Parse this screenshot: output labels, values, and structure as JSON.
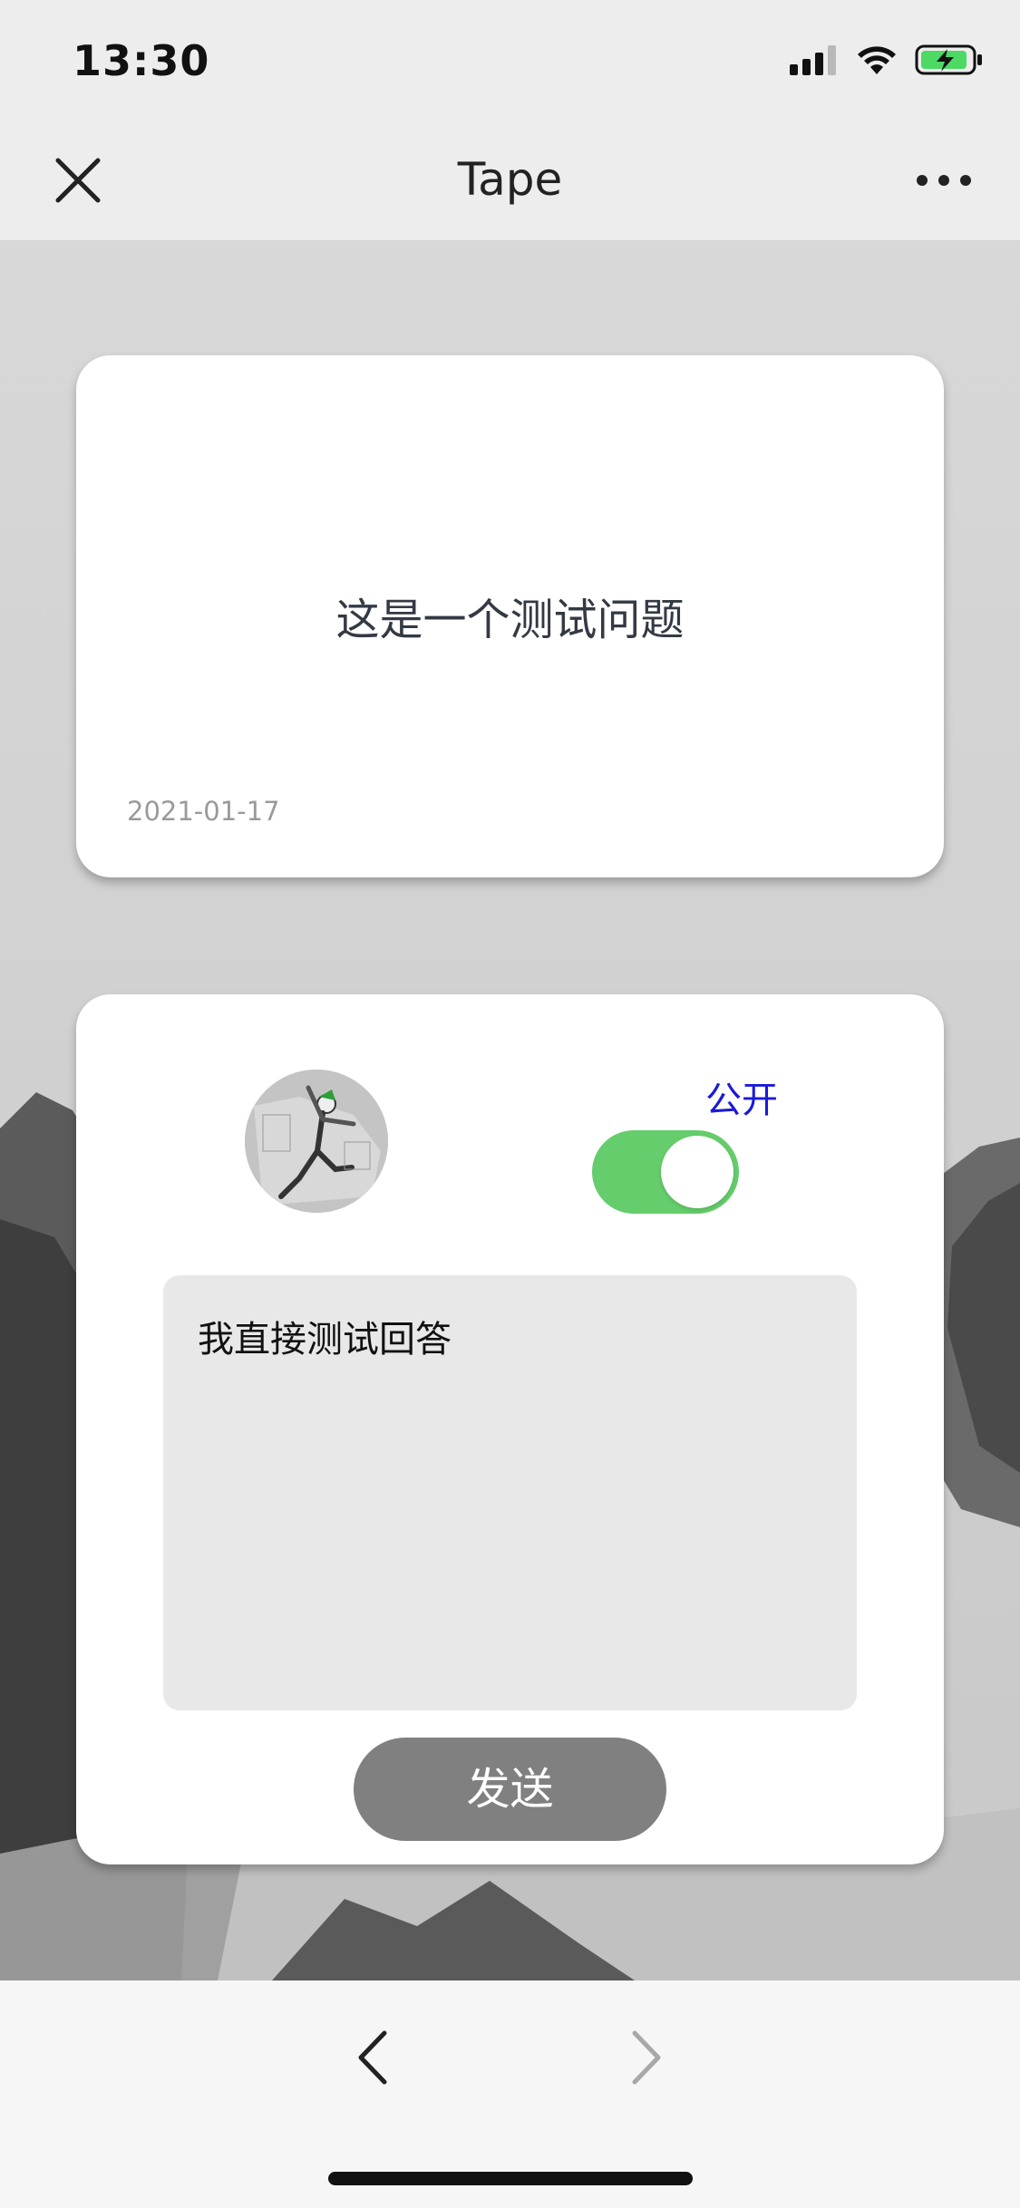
{
  "status_bar": {
    "time": "13:30",
    "icons": [
      "cellular-signal-icon",
      "wifi-icon",
      "battery-charging-icon"
    ]
  },
  "nav_bar": {
    "title": "Tape",
    "left_icon": "close-icon",
    "right_icon": "more-dots-icon"
  },
  "question_card": {
    "question": "这是一个测试问题",
    "date": "2021-01-17"
  },
  "answer_card": {
    "visibility_label": "公开",
    "visibility_on": true,
    "answer_value": "我直接测试回答",
    "send_label": "发送"
  },
  "bottom_bar": {
    "back_icon": "chevron-left-icon",
    "forward_icon": "chevron-right-icon"
  },
  "colors": {
    "toggle_on": "#65cd6b",
    "public_label": "#1a1ad6",
    "send_button": "#808080",
    "battery_green": "#4cd964"
  }
}
